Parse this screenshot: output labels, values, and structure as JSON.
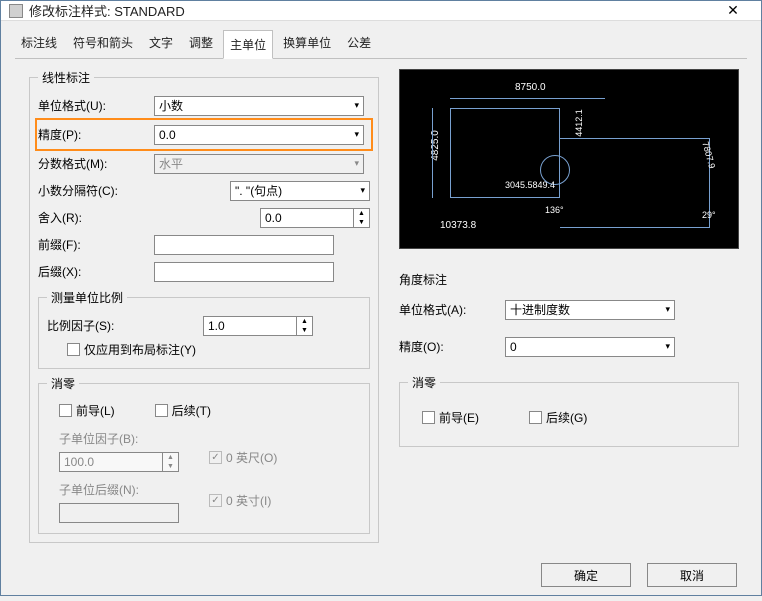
{
  "titlebar": {
    "title": "修改标注样式: STANDARD"
  },
  "tabs": {
    "t0": "标注线",
    "t1": "符号和箭头",
    "t2": "文字",
    "t3": "调整",
    "t4": "主单位",
    "t5": "换算单位",
    "t6": "公差"
  },
  "linear": {
    "legend": "线性标注",
    "unit_format_label": "单位格式(U):",
    "unit_format_value": "小数",
    "precision_label": "精度(P):",
    "precision_value": "0.0",
    "fraction_label": "分数格式(M):",
    "fraction_value": "水平",
    "decimal_sep_label": "小数分隔符(C):",
    "decimal_sep_value": "\". \"(句点)",
    "round_label": "舍入(R):",
    "round_value": "0.0",
    "prefix_label": "前缀(F):",
    "prefix_value": "",
    "suffix_label": "后缀(X):",
    "suffix_value": ""
  },
  "scale": {
    "legend": "测量单位比例",
    "factor_label": "比例因子(S):",
    "factor_value": "1.0",
    "layout_only_label": "仅应用到布局标注(Y)"
  },
  "zero_suppress": {
    "legend": "消零",
    "leading_label": "前导(L)",
    "trailing_label": "后续(T)",
    "sub_factor_label": "子单位因子(B):",
    "sub_factor_value": "100.0",
    "sub_suffix_label": "子单位后缀(N):",
    "feet_label": "0 英尺(O)",
    "inches_label": "0 英寸(I)"
  },
  "preview": {
    "dim_top": "8750.0",
    "dim_left": "4825.0",
    "dim_left2": "4412.1",
    "dim_center": "3045.5849.4",
    "dim_bottom": "10373.8",
    "dim_angle": "136°",
    "dim_right": "7807.9",
    "dim_rightang": "29°"
  },
  "angle": {
    "legend": "角度标注",
    "unit_format_label": "单位格式(A):",
    "unit_format_value": "十进制度数",
    "precision_label": "精度(O):",
    "precision_value": "0",
    "zero_legend": "消零",
    "leading_label": "前导(E)",
    "trailing_label": "后续(G)"
  },
  "buttons": {
    "ok": "确定",
    "cancel": "取消"
  }
}
